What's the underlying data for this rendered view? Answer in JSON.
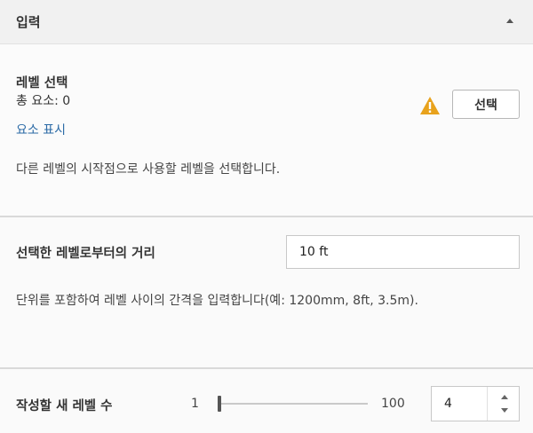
{
  "header": {
    "title": "입력",
    "collapse_icon": "chevron-up-icon"
  },
  "level_selection": {
    "title": "레벨 선택",
    "total_elements": "총 요소: 0",
    "show_elements_link": "요소 표시",
    "warning_icon": "warning-triangle-icon",
    "warning_color": "#e8a21c",
    "select_button": "선택",
    "description": "다른 레벨의 시작점으로 사용할 레벨을 선택합니다."
  },
  "distance": {
    "label": "선택한 레벨로부터의 거리",
    "value": "10 ft",
    "description": "단위를 포함하여 레벨 사이의 간격을 입력합니다(예: 1200mm, 8ft, 3.5m)."
  },
  "level_count": {
    "label": "작성할 새 레벨 수",
    "slider_min": "1",
    "slider_max": "100",
    "value": "4",
    "slider_value": 1
  },
  "colors": {
    "link": "#2b6aa6",
    "header_bg": "#f1f1f1"
  }
}
